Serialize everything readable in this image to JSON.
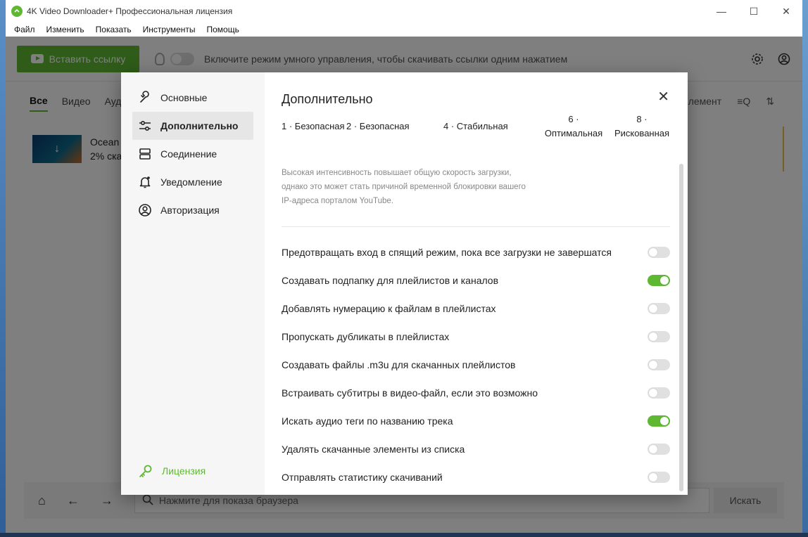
{
  "window": {
    "title": "4K Video Downloader+ Профессиональная лицензия",
    "controls": {
      "minimize": "—",
      "maximize": "☐",
      "close": "✕"
    }
  },
  "menu": [
    "Файл",
    "Изменить",
    "Показать",
    "Инструменты",
    "Помощь"
  ],
  "toolbar": {
    "paste_label": "Вставить ссылку",
    "smart_mode_text": "Включите режим умного управления, чтобы скачивать ссылки одним нажатием"
  },
  "tabs": [
    "Все",
    "Видео",
    "Ауд"
  ],
  "tabs_right_text": "лемент",
  "download_item": {
    "name": "Ocean",
    "progress_text": "2% ска"
  },
  "browser": {
    "placeholder": "Нажмите для показа браузера",
    "go_label": "Искать"
  },
  "dialog": {
    "sidebar": [
      {
        "label": "Основные",
        "icon": "wrench-icon",
        "active": false
      },
      {
        "label": "Дополнительно",
        "icon": "sliders-icon",
        "active": true
      },
      {
        "label": "Соединение",
        "icon": "server-icon",
        "active": false
      },
      {
        "label": "Уведомление",
        "icon": "bell-icon",
        "active": false
      },
      {
        "label": "Авторизация",
        "icon": "user-circle-icon",
        "active": false
      }
    ],
    "license_label": "Лицензия",
    "title": "Дополнительно",
    "close": "✕",
    "intensity_ticks": [
      {
        "line1": "1 · Безопасная",
        "line2": ""
      },
      {
        "line1": "2 · Безопасная",
        "line2": ""
      },
      {
        "line1": "4 · Стабильная",
        "line2": ""
      },
      {
        "line1": "6 ·",
        "line2": "Оптимальная"
      },
      {
        "line1": "8 ·",
        "line2": "Рискованная"
      }
    ],
    "hint": "Высокая интенсивность повышает общую скорость загрузки, однако это может стать причиной временной блокировки вашего IP-адреса порталом YouTube.",
    "options": [
      {
        "label": "Предотвращать вход в спящий режим, пока все загрузки не завершатся",
        "on": false
      },
      {
        "label": "Создавать подпапку для плейлистов и каналов",
        "on": true
      },
      {
        "label": "Добавлять нумерацию к файлам в плейлистах",
        "on": false
      },
      {
        "label": "Пропускать дубликаты в плейлистах",
        "on": false
      },
      {
        "label": "Создавать файлы .m3u для скачанных плейлистов",
        "on": false
      },
      {
        "label": "Встраивать субтитры в видео-файл, если это возможно",
        "on": false
      },
      {
        "label": "Искать аудио теги по названию трека",
        "on": true
      },
      {
        "label": "Удалять скачанные элементы из списка",
        "on": false
      },
      {
        "label": "Отправлять статистику скачиваний",
        "on": false
      }
    ]
  },
  "colors": {
    "accent": "#5fb832",
    "dim_overlay": "rgba(0,0,0,0.5)"
  }
}
